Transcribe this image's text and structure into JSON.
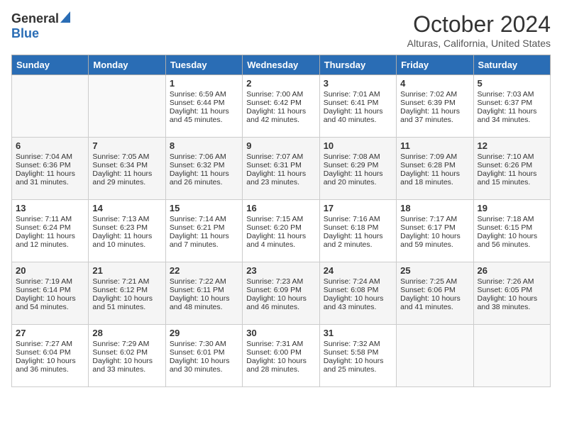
{
  "header": {
    "logo_general": "General",
    "logo_blue": "Blue",
    "month": "October 2024",
    "location": "Alturas, California, United States"
  },
  "weekdays": [
    "Sunday",
    "Monday",
    "Tuesday",
    "Wednesday",
    "Thursday",
    "Friday",
    "Saturday"
  ],
  "weeks": [
    [
      {
        "day": "",
        "info": ""
      },
      {
        "day": "",
        "info": ""
      },
      {
        "day": "1",
        "info": "Sunrise: 6:59 AM\nSunset: 6:44 PM\nDaylight: 11 hours and 45 minutes."
      },
      {
        "day": "2",
        "info": "Sunrise: 7:00 AM\nSunset: 6:42 PM\nDaylight: 11 hours and 42 minutes."
      },
      {
        "day": "3",
        "info": "Sunrise: 7:01 AM\nSunset: 6:41 PM\nDaylight: 11 hours and 40 minutes."
      },
      {
        "day": "4",
        "info": "Sunrise: 7:02 AM\nSunset: 6:39 PM\nDaylight: 11 hours and 37 minutes."
      },
      {
        "day": "5",
        "info": "Sunrise: 7:03 AM\nSunset: 6:37 PM\nDaylight: 11 hours and 34 minutes."
      }
    ],
    [
      {
        "day": "6",
        "info": "Sunrise: 7:04 AM\nSunset: 6:36 PM\nDaylight: 11 hours and 31 minutes."
      },
      {
        "day": "7",
        "info": "Sunrise: 7:05 AM\nSunset: 6:34 PM\nDaylight: 11 hours and 29 minutes."
      },
      {
        "day": "8",
        "info": "Sunrise: 7:06 AM\nSunset: 6:32 PM\nDaylight: 11 hours and 26 minutes."
      },
      {
        "day": "9",
        "info": "Sunrise: 7:07 AM\nSunset: 6:31 PM\nDaylight: 11 hours and 23 minutes."
      },
      {
        "day": "10",
        "info": "Sunrise: 7:08 AM\nSunset: 6:29 PM\nDaylight: 11 hours and 20 minutes."
      },
      {
        "day": "11",
        "info": "Sunrise: 7:09 AM\nSunset: 6:28 PM\nDaylight: 11 hours and 18 minutes."
      },
      {
        "day": "12",
        "info": "Sunrise: 7:10 AM\nSunset: 6:26 PM\nDaylight: 11 hours and 15 minutes."
      }
    ],
    [
      {
        "day": "13",
        "info": "Sunrise: 7:11 AM\nSunset: 6:24 PM\nDaylight: 11 hours and 12 minutes."
      },
      {
        "day": "14",
        "info": "Sunrise: 7:13 AM\nSunset: 6:23 PM\nDaylight: 11 hours and 10 minutes."
      },
      {
        "day": "15",
        "info": "Sunrise: 7:14 AM\nSunset: 6:21 PM\nDaylight: 11 hours and 7 minutes."
      },
      {
        "day": "16",
        "info": "Sunrise: 7:15 AM\nSunset: 6:20 PM\nDaylight: 11 hours and 4 minutes."
      },
      {
        "day": "17",
        "info": "Sunrise: 7:16 AM\nSunset: 6:18 PM\nDaylight: 11 hours and 2 minutes."
      },
      {
        "day": "18",
        "info": "Sunrise: 7:17 AM\nSunset: 6:17 PM\nDaylight: 10 hours and 59 minutes."
      },
      {
        "day": "19",
        "info": "Sunrise: 7:18 AM\nSunset: 6:15 PM\nDaylight: 10 hours and 56 minutes."
      }
    ],
    [
      {
        "day": "20",
        "info": "Sunrise: 7:19 AM\nSunset: 6:14 PM\nDaylight: 10 hours and 54 minutes."
      },
      {
        "day": "21",
        "info": "Sunrise: 7:21 AM\nSunset: 6:12 PM\nDaylight: 10 hours and 51 minutes."
      },
      {
        "day": "22",
        "info": "Sunrise: 7:22 AM\nSunset: 6:11 PM\nDaylight: 10 hours and 48 minutes."
      },
      {
        "day": "23",
        "info": "Sunrise: 7:23 AM\nSunset: 6:09 PM\nDaylight: 10 hours and 46 minutes."
      },
      {
        "day": "24",
        "info": "Sunrise: 7:24 AM\nSunset: 6:08 PM\nDaylight: 10 hours and 43 minutes."
      },
      {
        "day": "25",
        "info": "Sunrise: 7:25 AM\nSunset: 6:06 PM\nDaylight: 10 hours and 41 minutes."
      },
      {
        "day": "26",
        "info": "Sunrise: 7:26 AM\nSunset: 6:05 PM\nDaylight: 10 hours and 38 minutes."
      }
    ],
    [
      {
        "day": "27",
        "info": "Sunrise: 7:27 AM\nSunset: 6:04 PM\nDaylight: 10 hours and 36 minutes."
      },
      {
        "day": "28",
        "info": "Sunrise: 7:29 AM\nSunset: 6:02 PM\nDaylight: 10 hours and 33 minutes."
      },
      {
        "day": "29",
        "info": "Sunrise: 7:30 AM\nSunset: 6:01 PM\nDaylight: 10 hours and 30 minutes."
      },
      {
        "day": "30",
        "info": "Sunrise: 7:31 AM\nSunset: 6:00 PM\nDaylight: 10 hours and 28 minutes."
      },
      {
        "day": "31",
        "info": "Sunrise: 7:32 AM\nSunset: 5:58 PM\nDaylight: 10 hours and 25 minutes."
      },
      {
        "day": "",
        "info": ""
      },
      {
        "day": "",
        "info": ""
      }
    ]
  ]
}
